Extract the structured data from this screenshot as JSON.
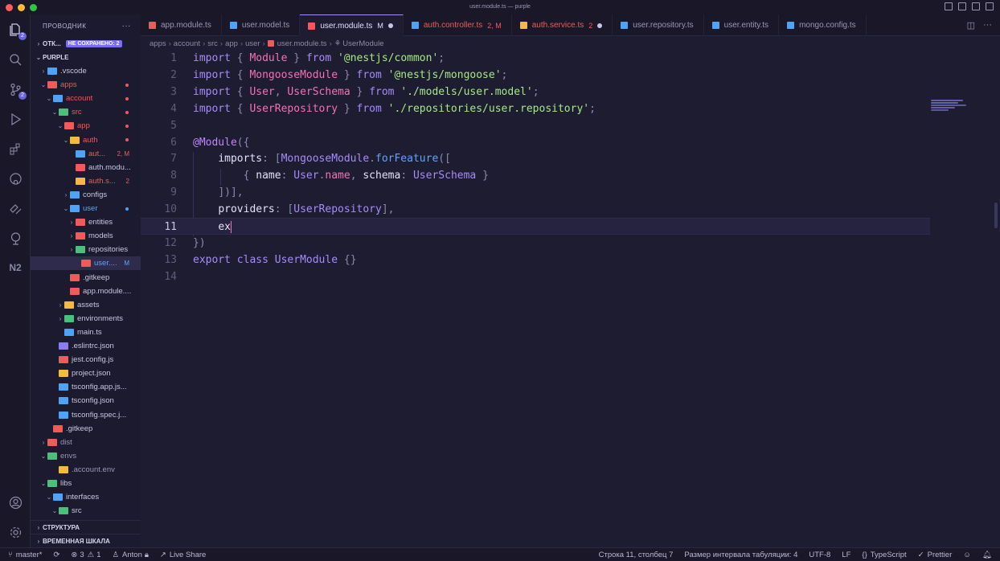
{
  "window": {
    "title": "user.module.ts — purple",
    "traffic_colors": [
      "#ff5f57",
      "#febc2e",
      "#28c840"
    ]
  },
  "activity": {
    "items": [
      {
        "name": "explorer",
        "badge": "2"
      },
      {
        "name": "search"
      },
      {
        "name": "source-control",
        "badge": "2"
      },
      {
        "name": "run-debug"
      },
      {
        "name": "extensions"
      },
      {
        "name": "github"
      },
      {
        "name": "remote"
      },
      {
        "name": "testing"
      },
      {
        "name": "nx"
      }
    ]
  },
  "sidebar": {
    "title": "ПРОВОДНИК",
    "more": "···",
    "open_editors": "ОТК...",
    "unsaved": "НЕ СОХРАНЕНО: 2",
    "root": "PURPLE",
    "tree": [
      {
        "label": ".vscode",
        "indent": 1,
        "chev": ">",
        "icon": "#4fa3f7"
      },
      {
        "label": "apps",
        "indent": 1,
        "chev": "v",
        "icon": "#f05a5a",
        "color": "#f05a5a",
        "dot": "#f05a5a"
      },
      {
        "label": "account",
        "indent": 2,
        "chev": "v",
        "icon": "#4fa3f7",
        "color": "#f05a5a",
        "dot": "#f05a5a"
      },
      {
        "label": "src",
        "indent": 3,
        "chev": "v",
        "icon": "#4bc07a",
        "color": "#f05a5a",
        "dot": "#f05a5a"
      },
      {
        "label": "app",
        "indent": 4,
        "chev": "v",
        "icon": "#f05a5a",
        "color": "#f05a5a",
        "dot": "#f05a5a"
      },
      {
        "label": "auth",
        "indent": 5,
        "chev": "v",
        "icon": "#f5b942",
        "color": "#f05a5a",
        "dot": "#f05a5a"
      },
      {
        "label": "aut...",
        "indent": 6,
        "icon": "#4fa3f7",
        "color": "#f05a5a",
        "status": "2, M"
      },
      {
        "label": "auth.modu...",
        "indent": 6,
        "icon": "#f05a5a",
        "color": "#c8c6e0"
      },
      {
        "label": "auth.s...",
        "indent": 6,
        "icon": "#f5b942",
        "color": "#f05a5a",
        "status": "2"
      },
      {
        "label": "configs",
        "indent": 5,
        "chev": ">",
        "icon": "#4fa3f7",
        "color": "#c8c6e0"
      },
      {
        "label": "user",
        "indent": 5,
        "chev": "v",
        "icon": "#4fa3f7",
        "color": "#60a5fa",
        "dot": "#4fa3f7"
      },
      {
        "label": "entities",
        "indent": 6,
        "chev": ">",
        "icon": "#f05a5a",
        "color": "#c8c6e0"
      },
      {
        "label": "models",
        "indent": 6,
        "chev": ">",
        "icon": "#f05a5a",
        "color": "#c8c6e0"
      },
      {
        "label": "repositories",
        "indent": 6,
        "chev": ">",
        "icon": "#4bc07a",
        "color": "#c8c6e0"
      },
      {
        "label": "user....",
        "indent": 7,
        "icon": "#f05a5a",
        "color": "#60a5fa",
        "status": "M",
        "selected": true
      },
      {
        "label": ".gitkeep",
        "indent": 5,
        "icon": "#f05a5a",
        "color": "#c8c6e0"
      },
      {
        "label": "app.module....",
        "indent": 5,
        "icon": "#f05a5a",
        "color": "#c8c6e0"
      },
      {
        "label": "assets",
        "indent": 4,
        "chev": ">",
        "icon": "#f5b942",
        "color": "#c8c6e0"
      },
      {
        "label": "environments",
        "indent": 4,
        "chev": ">",
        "icon": "#4bc07a",
        "color": "#c8c6e0"
      },
      {
        "label": "main.ts",
        "indent": 4,
        "icon": "#4fa3f7",
        "color": "#c8c6e0"
      },
      {
        "label": ".eslintrc.json",
        "indent": 3,
        "icon": "#8b7cf6",
        "color": "#c8c6e0"
      },
      {
        "label": "jest.config.js",
        "indent": 3,
        "icon": "#f05a5a",
        "color": "#c8c6e0"
      },
      {
        "label": "project.json",
        "indent": 3,
        "icon": "#f5b942",
        "color": "#c8c6e0"
      },
      {
        "label": "tsconfig.app.js...",
        "indent": 3,
        "icon": "#4fa3f7",
        "color": "#c8c6e0"
      },
      {
        "label": "tsconfig.json",
        "indent": 3,
        "icon": "#4fa3f7",
        "color": "#c8c6e0"
      },
      {
        "label": "tsconfig.spec.j...",
        "indent": 3,
        "icon": "#4fa3f7",
        "color": "#c8c6e0"
      },
      {
        "label": ".gitkeep",
        "indent": 2,
        "icon": "#f05a5a",
        "color": "#c8c6e0"
      },
      {
        "label": "dist",
        "indent": 1,
        "chev": ">",
        "icon": "#f05a5a",
        "color": "#9896b4"
      },
      {
        "label": "envs",
        "indent": 1,
        "chev": "v",
        "icon": "#4bc07a",
        "color": "#9896b4"
      },
      {
        "label": ".account.env",
        "indent": 3,
        "icon": "#f5b942",
        "color": "#9896b4"
      },
      {
        "label": "libs",
        "indent": 1,
        "chev": "v",
        "icon": "#4bc07a",
        "color": "#c8c6e0"
      },
      {
        "label": "interfaces",
        "indent": 2,
        "chev": "v",
        "icon": "#4fa3f7",
        "color": "#c8c6e0"
      },
      {
        "label": "src",
        "indent": 3,
        "chev": "v",
        "icon": "#4bc07a",
        "color": "#c8c6e0"
      }
    ],
    "footer_structure": "СТРУКТУРА",
    "footer_timeline": "ВРЕМЕННАЯ ШКАЛА"
  },
  "tabs": [
    {
      "label": "app.module.ts",
      "icon": "#f05a5a",
      "color": "#9896b4"
    },
    {
      "label": "user.model.ts",
      "icon": "#4fa3f7",
      "color": "#9896b4"
    },
    {
      "label": "user.module.ts",
      "icon": "#f05a5a",
      "color": "#e2e0f8",
      "status": "M",
      "active": true,
      "dirty": true
    },
    {
      "label": "auth.controller.ts",
      "icon": "#4fa3f7",
      "color": "#f05a5a",
      "status": "2, M"
    },
    {
      "label": "auth.service.ts",
      "icon": "#f5b942",
      "color": "#f05a5a",
      "status": "2",
      "dirty": true
    },
    {
      "label": "user.repository.ts",
      "icon": "#4fa3f7",
      "color": "#9896b4"
    },
    {
      "label": "user.entity.ts",
      "icon": "#4fa3f7",
      "color": "#9896b4"
    },
    {
      "label": "mongo.config.ts",
      "icon": "#4fa3f7",
      "color": "#9896b4"
    }
  ],
  "breadcrumb": [
    "apps",
    "account",
    "src",
    "app",
    "user",
    "user.module.ts",
    "UserModule"
  ],
  "editor": {
    "current_line": 11,
    "lines": [
      [
        [
          "kw",
          "import"
        ],
        [
          "punc",
          " { "
        ],
        [
          "cls",
          "Module"
        ],
        [
          "punc",
          " } "
        ],
        [
          "kw",
          "from"
        ],
        [
          "plain",
          " "
        ],
        [
          "str",
          "'@nestjs/common'"
        ],
        [
          "punc",
          ";"
        ]
      ],
      [
        [
          "kw",
          "import"
        ],
        [
          "punc",
          " { "
        ],
        [
          "cls",
          "MongooseModule"
        ],
        [
          "punc",
          " } "
        ],
        [
          "kw",
          "from"
        ],
        [
          "plain",
          " "
        ],
        [
          "str",
          "'@nestjs/mongoose'"
        ],
        [
          "punc",
          ";"
        ]
      ],
      [
        [
          "kw",
          "import"
        ],
        [
          "punc",
          " { "
        ],
        [
          "cls",
          "User"
        ],
        [
          "punc",
          ", "
        ],
        [
          "cls",
          "UserSchema"
        ],
        [
          "punc",
          " } "
        ],
        [
          "kw",
          "from"
        ],
        [
          "plain",
          " "
        ],
        [
          "str",
          "'./models/user.model'"
        ],
        [
          "punc",
          ";"
        ]
      ],
      [
        [
          "kw",
          "import"
        ],
        [
          "punc",
          " { "
        ],
        [
          "cls",
          "UserRepository"
        ],
        [
          "punc",
          " } "
        ],
        [
          "kw",
          "from"
        ],
        [
          "plain",
          " "
        ],
        [
          "str",
          "'./repositories/user.repository'"
        ],
        [
          "punc",
          ";"
        ]
      ],
      [],
      [
        [
          "dec",
          "@Module"
        ],
        [
          "punc",
          "({"
        ]
      ],
      [
        [
          "plain",
          "    "
        ],
        [
          "prop",
          "imports"
        ],
        [
          "punc",
          ": ["
        ],
        [
          "kw",
          "MongooseModule"
        ],
        [
          "punc",
          "."
        ],
        [
          "fn",
          "forFeature"
        ],
        [
          "punc",
          "(["
        ]
      ],
      [
        [
          "plain",
          "        "
        ],
        [
          "punc",
          "{ "
        ],
        [
          "prop",
          "name"
        ],
        [
          "punc",
          ": "
        ],
        [
          "kw",
          "User"
        ],
        [
          "punc",
          "."
        ],
        [
          "cls",
          "name"
        ],
        [
          "punc",
          ", "
        ],
        [
          "prop",
          "schema"
        ],
        [
          "punc",
          ": "
        ],
        [
          "kw",
          "UserSchema"
        ],
        [
          "punc",
          " }"
        ]
      ],
      [
        [
          "plain",
          "    "
        ],
        [
          "punc",
          "])],"
        ]
      ],
      [
        [
          "plain",
          "    "
        ],
        [
          "prop",
          "providers"
        ],
        [
          "punc",
          ": ["
        ],
        [
          "kw",
          "UserRepository"
        ],
        [
          "punc",
          "],"
        ]
      ],
      [
        [
          "plain",
          "    "
        ],
        [
          "prop",
          "ex"
        ]
      ],
      [
        [
          "punc",
          "})"
        ]
      ],
      [
        [
          "kw",
          "export"
        ],
        [
          "plain",
          " "
        ],
        [
          "kw",
          "class"
        ],
        [
          "plain",
          " "
        ],
        [
          "kw",
          "UserModule"
        ],
        [
          "plain",
          " "
        ],
        [
          "punc",
          "{}"
        ]
      ],
      []
    ]
  },
  "statusbar": {
    "branch": "master*",
    "errors": "3",
    "warnings": "1",
    "user": "Anton",
    "live_share": "Live Share",
    "position": "Строка 11, столбец 7",
    "indent": "Размер интервала табуляции: 4",
    "encoding": "UTF-8",
    "eol": "LF",
    "language": "TypeScript",
    "formatter": "Prettier"
  }
}
